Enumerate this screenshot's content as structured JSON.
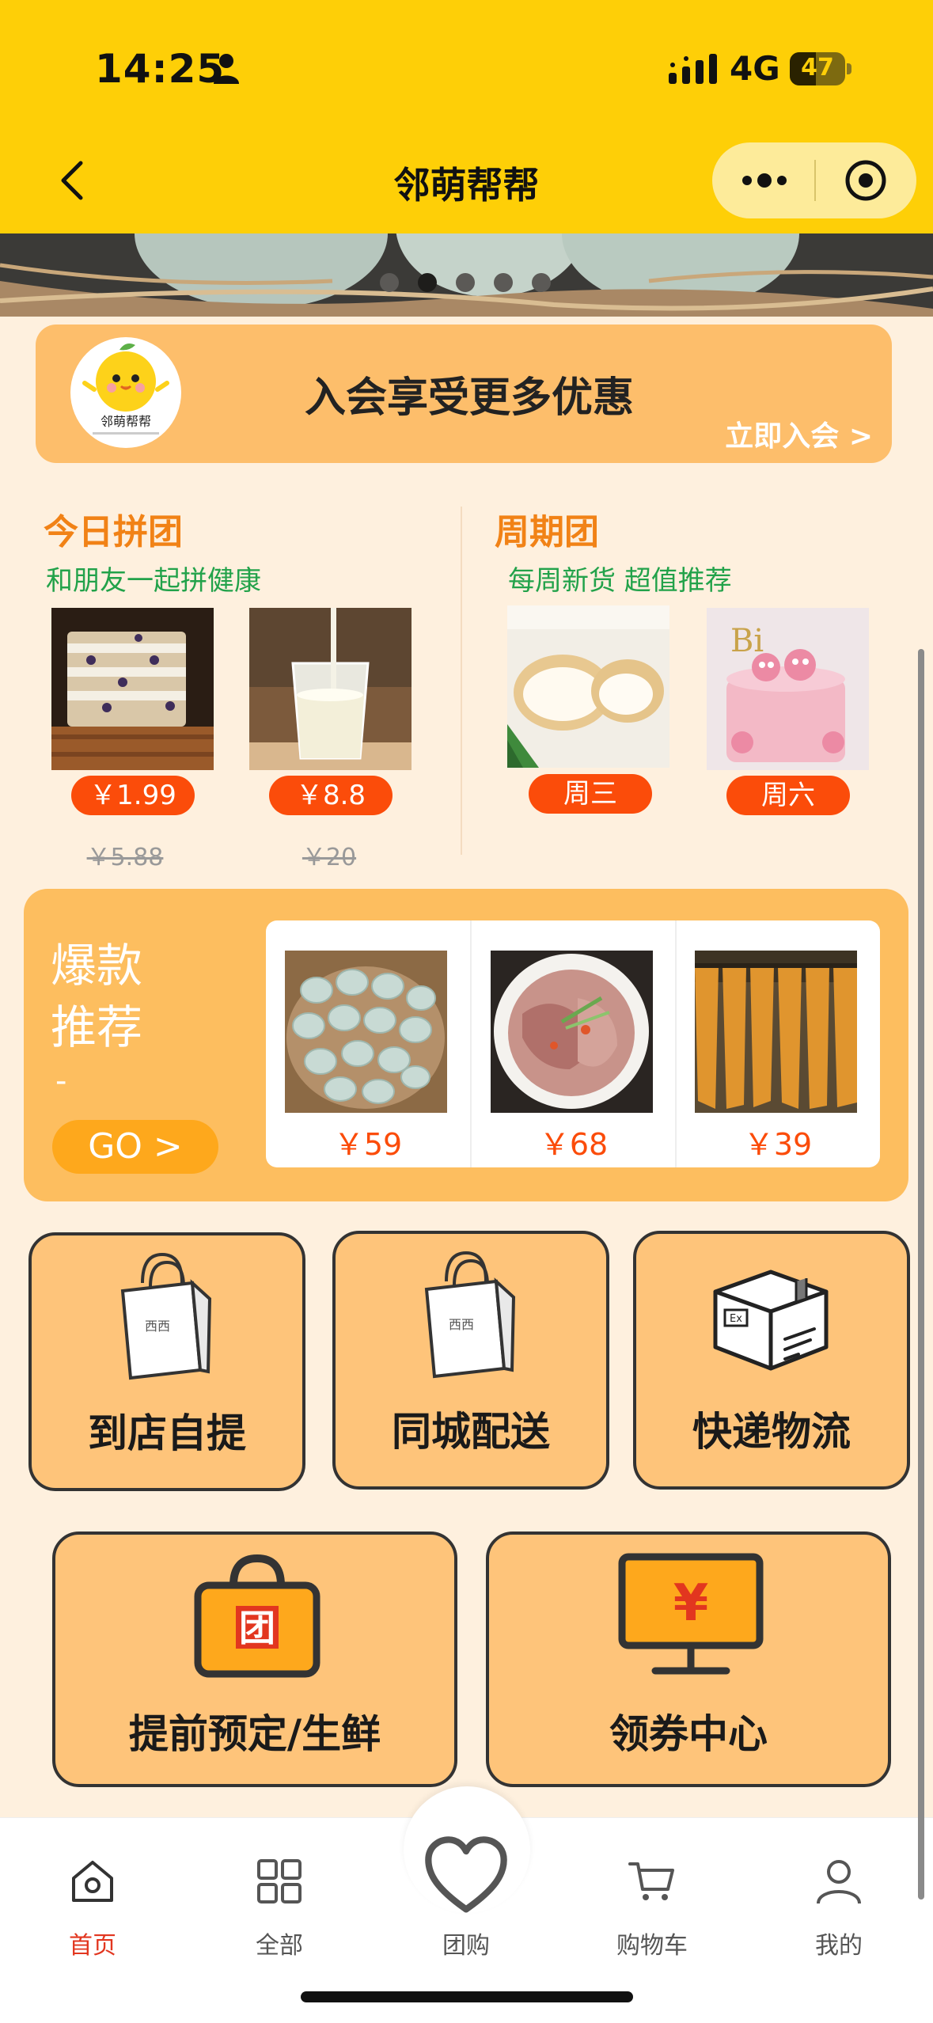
{
  "status_bar": {
    "time": "14:25",
    "network": "4G",
    "battery_level": 47,
    "battery": "47"
  },
  "nav": {
    "title": "邻萌帮帮"
  },
  "banner": {
    "slide_count": 5,
    "active_slide": 2
  },
  "member": {
    "logo_text": "邻萌帮帮",
    "title": "入会享受更多优惠",
    "link": "立即入会 >"
  },
  "group_today": {
    "title": "今日拼团",
    "subtitle": "和朋友一起拼健康",
    "items": [
      {
        "image": "sandwich-photo",
        "price": "￥1.99",
        "old_price": "￥5.88"
      },
      {
        "image": "milk-photo",
        "price": "￥8.8",
        "old_price": "￥20"
      }
    ]
  },
  "group_weekly": {
    "title": "周期团",
    "subtitle": "每周新货 超值推荐",
    "items": [
      {
        "image": "cream-puff-photo",
        "day": "周三"
      },
      {
        "image": "cake-photo",
        "day": "周六"
      }
    ]
  },
  "hot": {
    "title_line1": "爆款",
    "title_line2": "推荐",
    "dash": "-",
    "go": "GO >",
    "items": [
      {
        "image": "duck-eggs-photo",
        "price": "￥59"
      },
      {
        "image": "chicken-photo",
        "price": "￥68"
      },
      {
        "image": "yuba-photo",
        "price": "￥39"
      }
    ]
  },
  "services": [
    {
      "label": "到店自提",
      "icon": "shopping-bag-icon"
    },
    {
      "label": "同城配送",
      "icon": "shopping-bag-icon"
    },
    {
      "label": "快递物流",
      "icon": "package-box-icon"
    },
    {
      "label": "提前预定/生鲜",
      "icon": "group-bag-icon",
      "icon_text": "团"
    },
    {
      "label": "领券中心",
      "icon": "monitor-yen-icon",
      "icon_text": "¥"
    }
  ],
  "tabs": [
    {
      "label": "首页",
      "icon": "home-icon",
      "active": true
    },
    {
      "label": "全部",
      "icon": "grid-icon",
      "active": false
    },
    {
      "label": "团购",
      "icon": "heart-icon",
      "active": false
    },
    {
      "label": "购物车",
      "icon": "cart-icon",
      "active": false
    },
    {
      "label": "我的",
      "icon": "user-icon",
      "active": false
    }
  ],
  "colors": {
    "brand_yellow": "#FECF07",
    "page_bg": "#FEF0DE",
    "accent_orange": "#F18216",
    "price_red": "#FB4C0A",
    "green_text": "#22A24A",
    "tab_active": "#E2361F"
  }
}
